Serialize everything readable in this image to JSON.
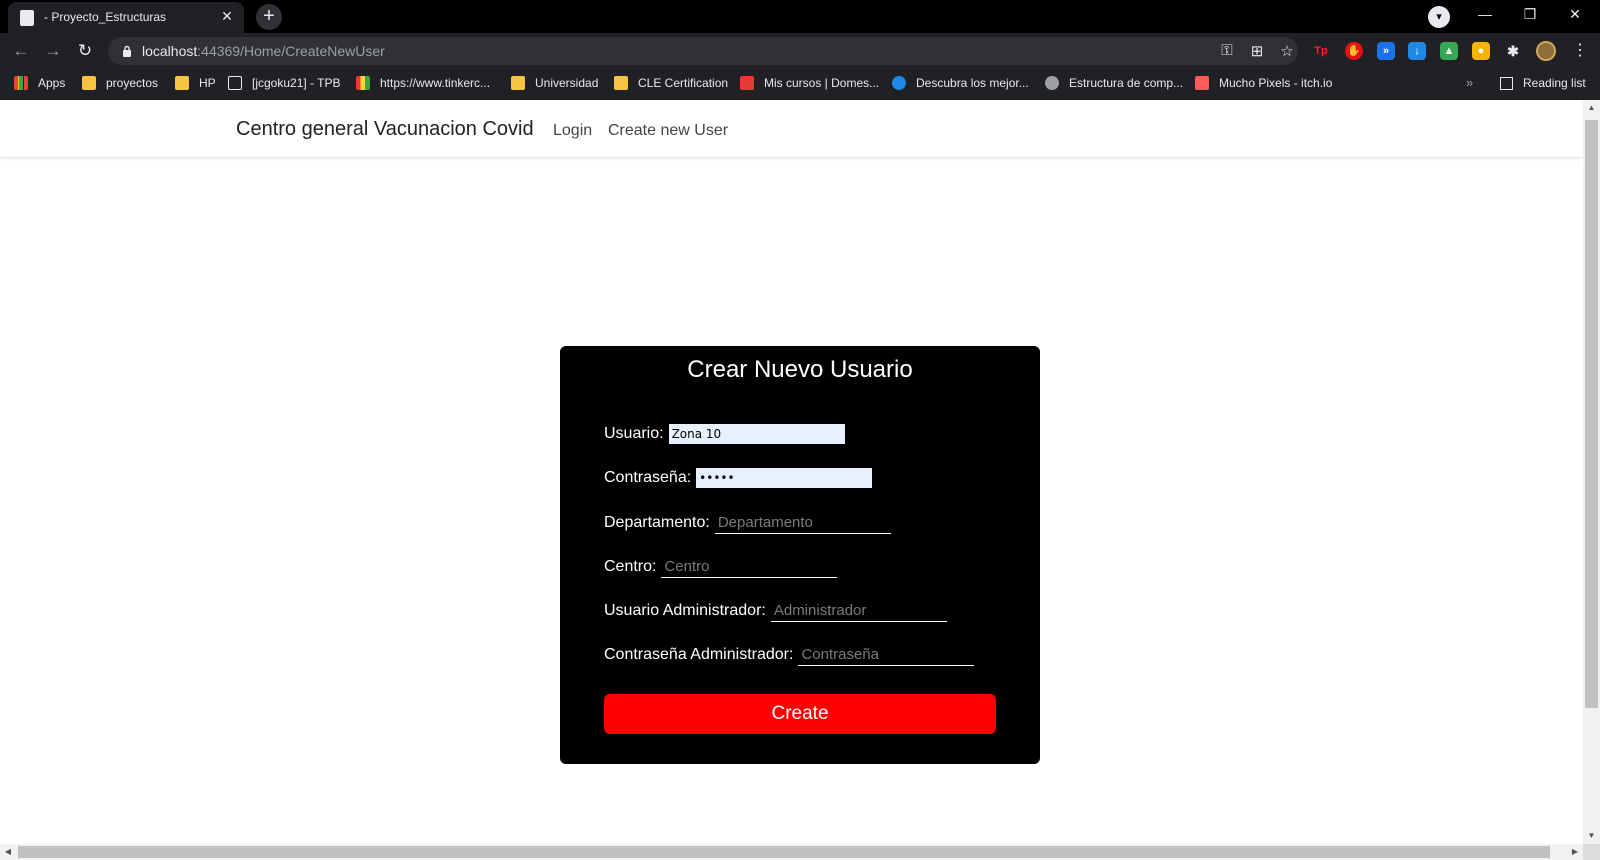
{
  "browser": {
    "tab_title": "- Proyecto_Estructuras",
    "tab_close": "✕",
    "new_tab": "+",
    "url_host": "localhost",
    "url_path": ":44369/Home/CreateNewUser",
    "window_controls": {
      "minimize": "—",
      "restore": "❐",
      "close": "✕"
    },
    "nav": {
      "back": "←",
      "forward": "→",
      "reload": "↻"
    },
    "omnibox_icons": [
      "key-icon",
      "translate-icon",
      "star-icon"
    ],
    "extensions": [
      "tp-ext-icon",
      "adblock-icon",
      "forward-ext-icon",
      "download-ext-icon",
      "drive-ext-icon",
      "hangouts-ext-icon",
      "puzzle-icon"
    ],
    "bookmarks": [
      {
        "label": "Apps",
        "icon": "apps-grid-icon"
      },
      {
        "label": "proyectos",
        "icon": "folder-icon"
      },
      {
        "label": "HP",
        "icon": "folder-icon"
      },
      {
        "label": "[jcgoku21] - TPB",
        "icon": "tpb-icon"
      },
      {
        "label": "https://www.tinkerc...",
        "icon": "tinkercad-icon"
      },
      {
        "label": "Universidad",
        "icon": "folder-icon"
      },
      {
        "label": "CLE Certification",
        "icon": "folder-icon"
      },
      {
        "label": "Mis cursos | Domes...",
        "icon": "domestika-icon"
      },
      {
        "label": "Descubra los mejor...",
        "icon": "globe-s-icon"
      },
      {
        "label": "Estructura de comp...",
        "icon": "globe-icon"
      },
      {
        "label": "Mucho Pixels - itch.io",
        "icon": "itch-icon"
      }
    ],
    "reading_list": "Reading list",
    "more_bookmarks": "»"
  },
  "navbar": {
    "brand": "Centro general Vacunacion Covid",
    "links": [
      "Login",
      "Create new User"
    ]
  },
  "form": {
    "title": "Crear Nuevo Usuario",
    "usuario_label": "Usuario:",
    "usuario_value": "Zona 10",
    "contrasena_label": "Contraseña:",
    "contrasena_value": "•••••",
    "departamento_label": "Departamento:",
    "departamento_placeholder": "Departamento",
    "centro_label": "Centro:",
    "centro_placeholder": "Centro",
    "admin_user_label": "Usuario Administrador:",
    "admin_user_placeholder": "Administrador",
    "admin_pass_label": "Contraseña Administrador:",
    "admin_pass_placeholder": "Contraseña",
    "submit_label": "Create"
  },
  "colors": {
    "card_bg": "#000000",
    "button_bg": "#ff0000",
    "autofill_bg": "#e8f0fe"
  }
}
